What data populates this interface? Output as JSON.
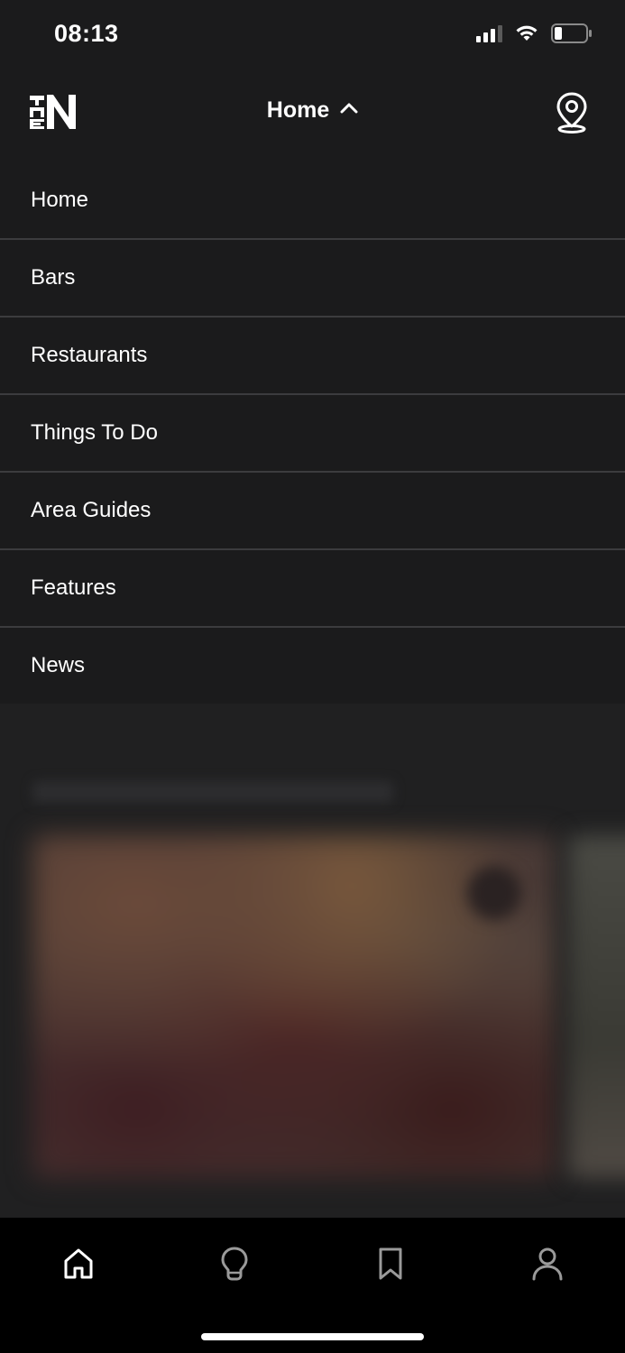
{
  "status_bar": {
    "time": "08:13"
  },
  "header": {
    "logo_icon": "the-n-logo",
    "title": "Home",
    "title_chevron_icon": "chevron-up-icon",
    "location_icon": "map-pin-icon"
  },
  "menu": {
    "items": [
      {
        "label": "Home"
      },
      {
        "label": "Bars"
      },
      {
        "label": "Restaurants"
      },
      {
        "label": "Things To Do"
      },
      {
        "label": "Area Guides"
      },
      {
        "label": "Features"
      },
      {
        "label": "News"
      }
    ]
  },
  "tab_bar": {
    "tabs": [
      {
        "icon": "home-icon"
      },
      {
        "icon": "lightbulb-icon"
      },
      {
        "icon": "bookmark-icon"
      },
      {
        "icon": "profile-icon"
      }
    ]
  },
  "colors": {
    "background": "#1b1b1c",
    "divider": "#3c3c3e",
    "tab_bar": "#000000",
    "text": "#ffffff"
  }
}
